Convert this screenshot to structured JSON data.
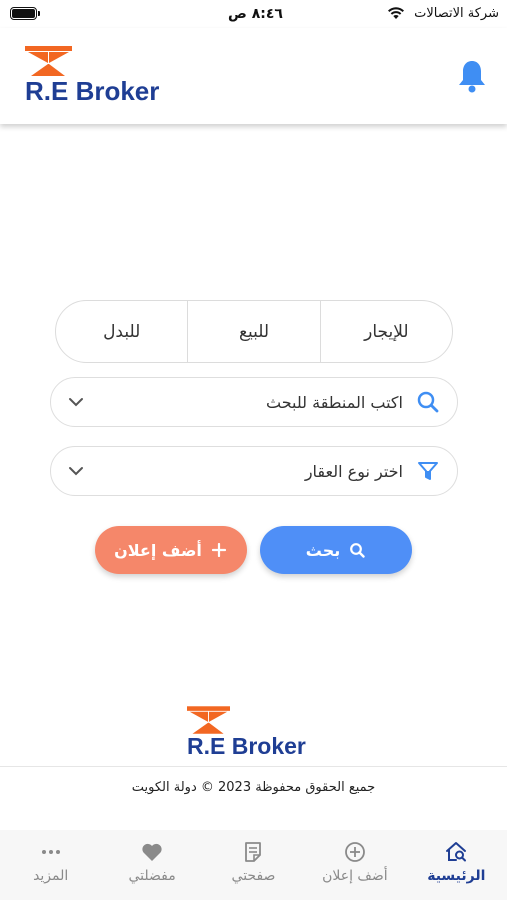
{
  "status_bar": {
    "carrier": "شركة الاتصالات",
    "time": "٨:٤٦ ص"
  },
  "header": {
    "brand": "R.E Broker",
    "icons": {
      "bell": "bell-icon"
    }
  },
  "segment": {
    "tabs": [
      {
        "label": "للإيجار"
      },
      {
        "label": "للبيع"
      },
      {
        "label": "للبدل"
      }
    ]
  },
  "search": {
    "area_placeholder": "اكتب المنطقة للبحث",
    "type_placeholder": "اختر نوع العقار"
  },
  "buttons": {
    "search_label": "بحث",
    "add_label": "أضف إعلان"
  },
  "footer": {
    "brand": "R.E Broker",
    "copyright": "جميع الحقوق محفوظة 2023 © دولة الكويت"
  },
  "bottom_nav": {
    "items": [
      {
        "label": "الرئيسية",
        "icon": "home-search-icon",
        "active": true
      },
      {
        "label": "أضف إعلان",
        "icon": "plus-circle-icon"
      },
      {
        "label": "صفحتي",
        "icon": "document-icon"
      },
      {
        "label": "مفضلتي",
        "icon": "heart-icon"
      },
      {
        "label": "المزيد",
        "icon": "more-icon"
      }
    ]
  },
  "colors": {
    "brand_blue": "#1f3e94",
    "brand_orange": "#f26722",
    "search_button": "#4f8ff7",
    "add_button": "#f5876a",
    "accent_icon": "#3f8ef3"
  }
}
